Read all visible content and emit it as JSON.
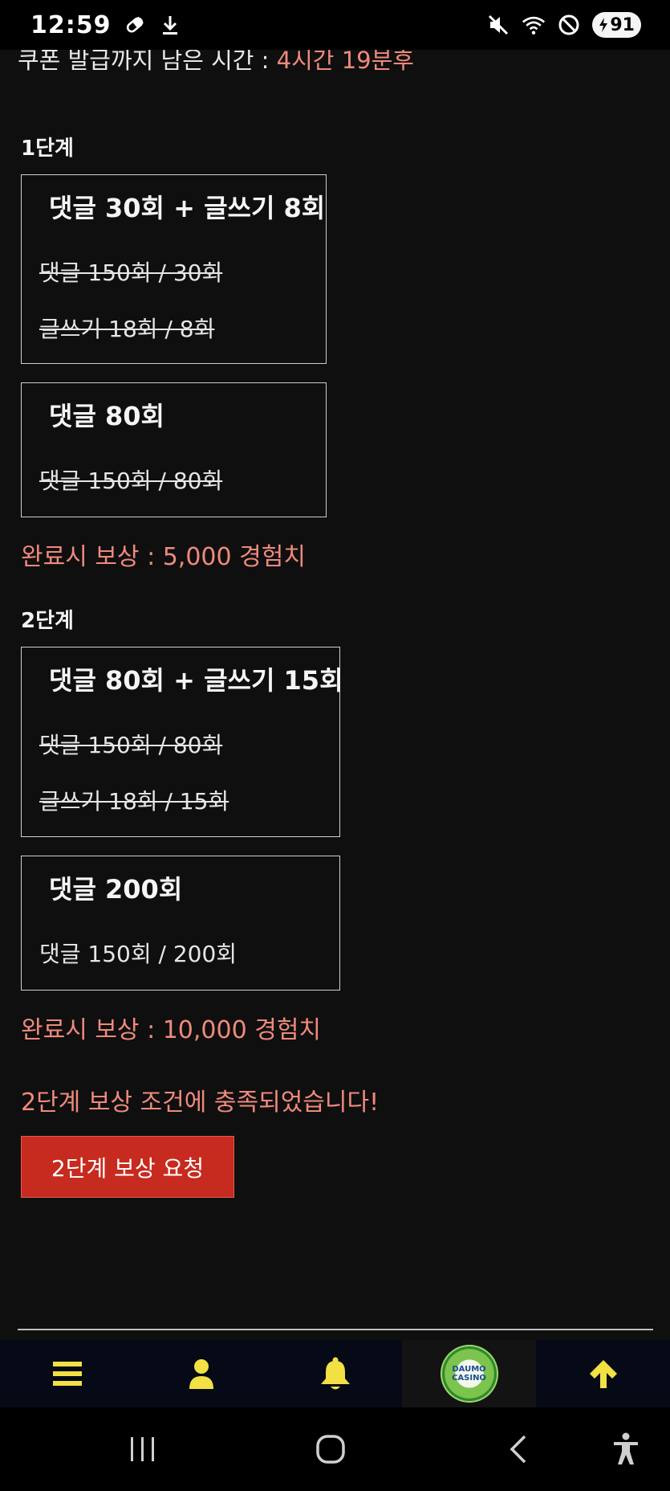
{
  "status_bar": {
    "time": "12:59",
    "battery_level": "91",
    "icons": [
      "pill-icon",
      "download-icon",
      "mute-icon",
      "wifi-icon",
      "do-not-disturb-icon",
      "battery-icon"
    ]
  },
  "countdown": {
    "label": "쿠폰 발급까지 남은 시간 : ",
    "value": "4시간 19분후"
  },
  "stages": [
    {
      "label": "1단계",
      "missions": [
        {
          "title": "댓글 30회 + 글쓰기 8회",
          "lines": [
            {
              "text": "댓글 150회 / 30회",
              "completed": true
            },
            {
              "text": "글쓰기 18회 / 8회",
              "completed": true
            }
          ]
        },
        {
          "title": "댓글 80회",
          "lines": [
            {
              "text": "댓글 150회 / 80회",
              "completed": true
            }
          ]
        }
      ],
      "reward": "완료시 보상 : 5,000 경험치"
    },
    {
      "label": "2단계",
      "missions": [
        {
          "title": "댓글 80회 + 글쓰기 15회",
          "lines": [
            {
              "text": "댓글 150회 / 80회",
              "completed": true
            },
            {
              "text": "글쓰기 18회 / 15회",
              "completed": true
            }
          ]
        },
        {
          "title": "댓글 200회",
          "lines": [
            {
              "text": "댓글 150회 / 200회",
              "completed": false
            }
          ]
        }
      ],
      "reward": "완료시 보상 : 10,000 경험치"
    }
  ],
  "notice": "2단계 보상 조건에 충족되었습니다!",
  "request_button": "2단계 보상 요청",
  "bottom_nav": {
    "items": [
      "menu-icon",
      "user-icon",
      "bell-icon",
      "daumo-casino-logo",
      "arrow-up-icon"
    ],
    "logo_text": [
      "DAUMO",
      "CASINO"
    ]
  },
  "colors": {
    "background": "#0f0f0f",
    "accent_text": "#f08a7c",
    "button": "#c72a1f",
    "nav_icon": "#f2e044",
    "nav_bg": "#050a16"
  }
}
